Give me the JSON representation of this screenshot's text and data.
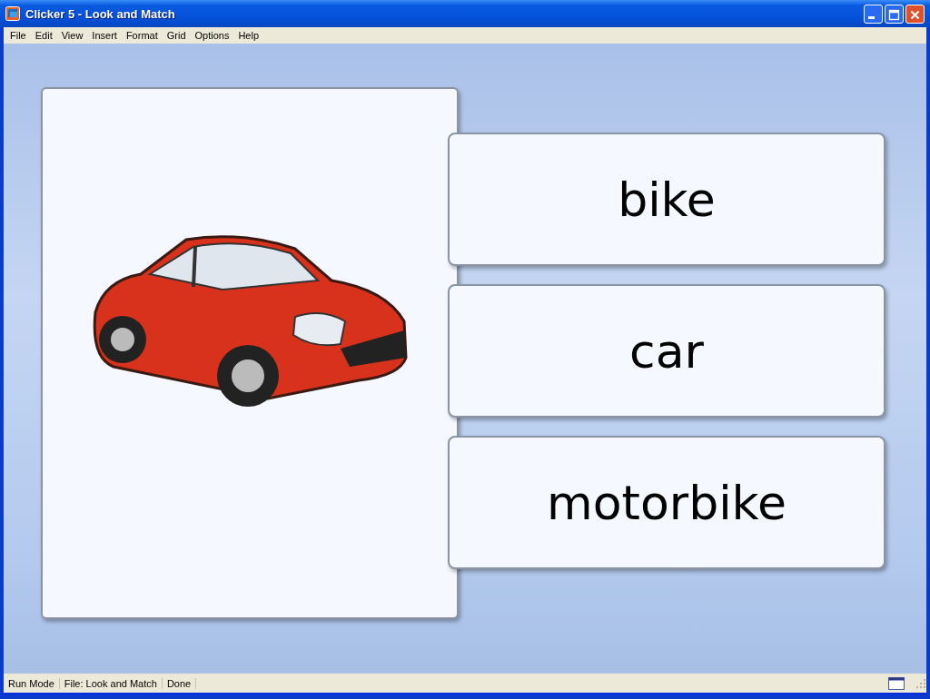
{
  "window": {
    "title": "Clicker 5 - Look and Match"
  },
  "menu": [
    "File",
    "Edit",
    "View",
    "Insert",
    "Format",
    "Grid",
    "Options",
    "Help"
  ],
  "word_cards": [
    {
      "label": "bike"
    },
    {
      "label": "car"
    },
    {
      "label": "motorbike"
    }
  ],
  "status_bar": [
    "Run Mode",
    "File: Look and Match",
    "Done"
  ]
}
